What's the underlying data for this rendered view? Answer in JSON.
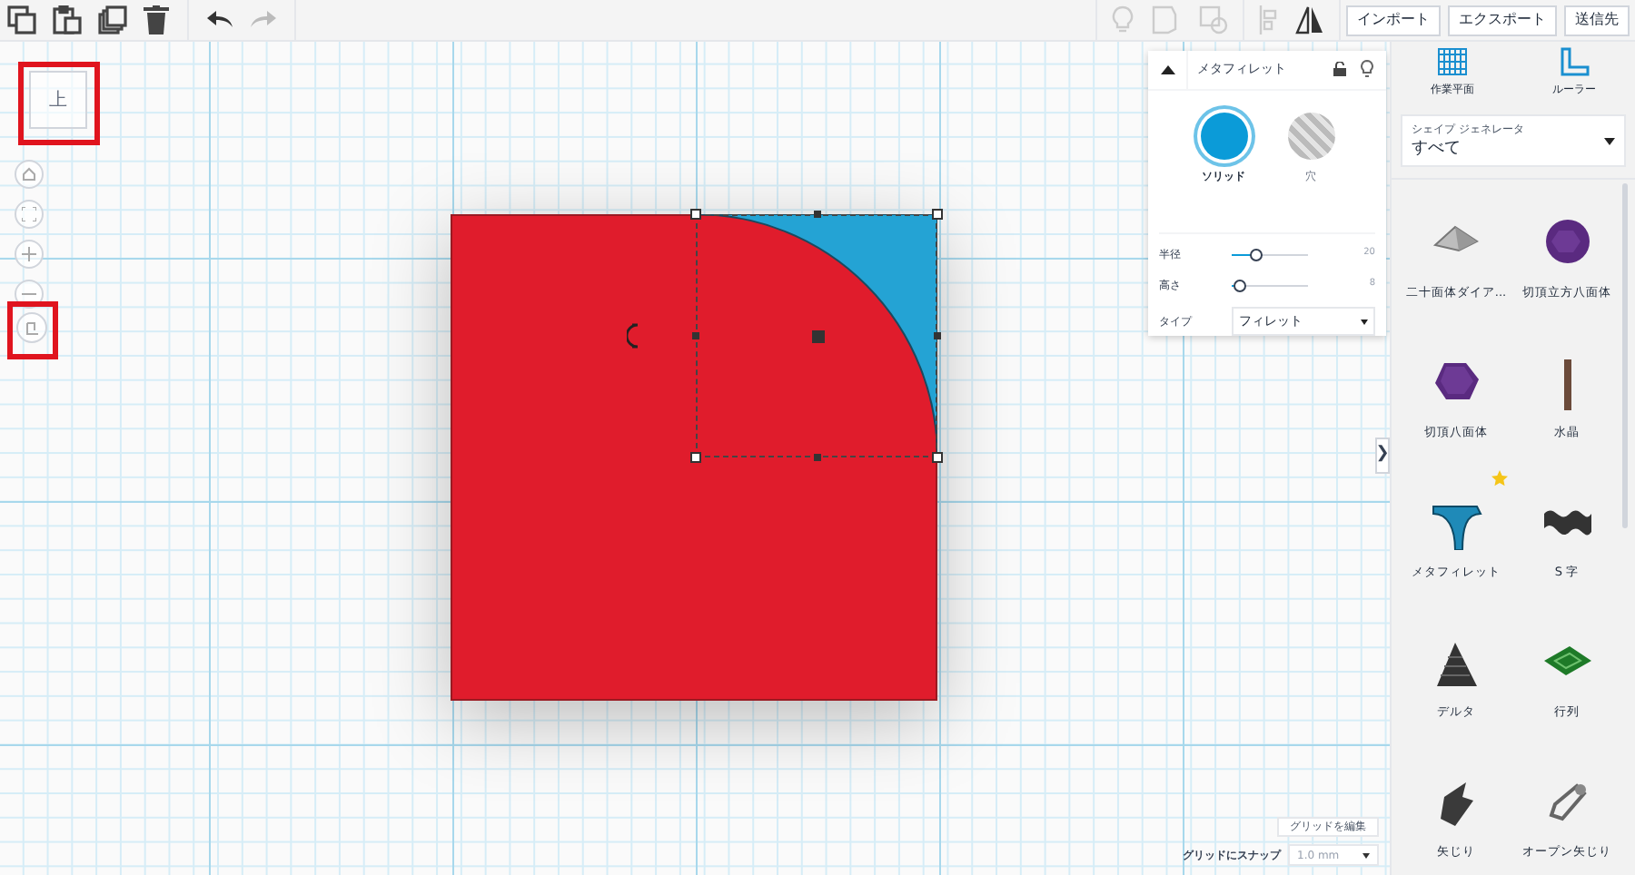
{
  "toolbar": {
    "buttons": [
      {
        "label": "インポート"
      },
      {
        "label": "エクスポート"
      },
      {
        "label": "送信先"
      }
    ]
  },
  "view_cube": {
    "label": "上"
  },
  "inspector": {
    "title": "メタフィレット",
    "modes": [
      {
        "label": "ソリッド",
        "selected": true
      },
      {
        "label": "穴",
        "selected": false
      }
    ],
    "params": [
      {
        "label": "半径",
        "level": 0.3,
        "reading": "20"
      },
      {
        "label": "高さ",
        "level": 0.1,
        "reading": "8"
      }
    ],
    "type": {
      "label": "タイプ",
      "value": "フィレット"
    }
  },
  "panel_toggle": "❯",
  "tools": [
    {
      "label": "作業平面"
    },
    {
      "label": "ルーラー"
    }
  ],
  "generator": {
    "label": "シェイプ ジェネレータ",
    "value": "すべて"
  },
  "shapes": [
    {
      "name": "二十面体ダイア...",
      "favorite": false
    },
    {
      "name": "切頂立方八面体",
      "favorite": false
    },
    {
      "name": "切頂八面体",
      "favorite": false
    },
    {
      "name": "水晶",
      "favorite": false
    },
    {
      "name": "メタフィレット",
      "favorite": true
    },
    {
      "name": "S 字",
      "favorite": false
    },
    {
      "name": "デルタ",
      "favorite": false
    },
    {
      "name": "行列",
      "favorite": false
    },
    {
      "name": "矢じり",
      "favorite": false
    },
    {
      "name": "オープン矢じり",
      "favorite": false
    }
  ],
  "grid": {
    "edit": "グリッドを編集",
    "snap_label": "グリッドにスナップ",
    "snap_value": "1.0 mm"
  }
}
